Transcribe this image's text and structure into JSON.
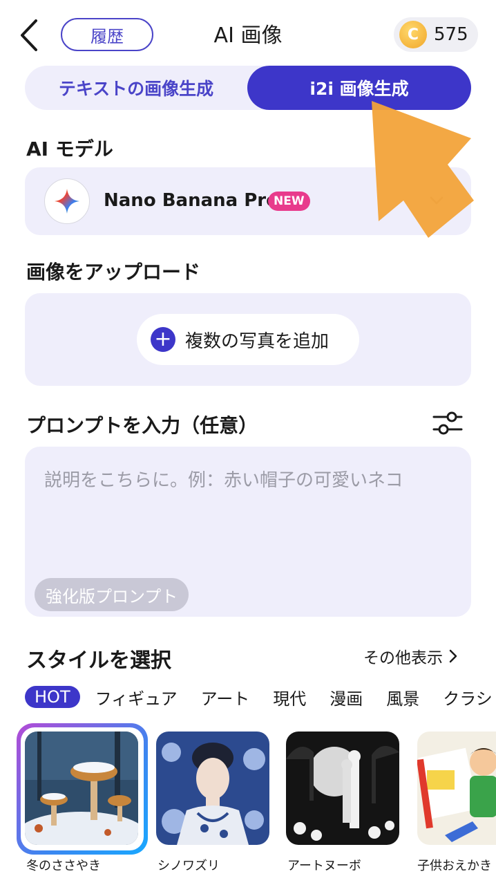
{
  "header": {
    "back_icon": "chevron-left-icon",
    "history_label": "履歴",
    "title": "AI 画像",
    "coin_symbol": "C",
    "coin_count": "575"
  },
  "tabs": [
    {
      "label": "テキストの画像生成",
      "active": false
    },
    {
      "label": "i2i 画像生成",
      "active": true
    }
  ],
  "model": {
    "section_label": "AI モデル",
    "name": "Nano Banana Pro",
    "badge": "NEW"
  },
  "upload": {
    "section_label": "画像をアップロード",
    "button_label": "複数の写真を追加"
  },
  "prompt": {
    "section_label": "プロンプトを入力（任意）",
    "placeholder": "説明をこちらに。例：赤い帽子の可愛いネコ",
    "enhance_label": "強化版プロンプト"
  },
  "styles": {
    "section_label": "スタイルを選択",
    "more_label": "その他表示",
    "categories": [
      "HOT",
      "フィギュア",
      "アート",
      "現代",
      "漫画",
      "風景",
      "クラシ"
    ],
    "items": [
      {
        "caption": "冬のささやき",
        "selected": true
      },
      {
        "caption": "シノワズリ",
        "selected": false
      },
      {
        "caption": "アートヌーボ",
        "selected": false
      },
      {
        "caption": "子供おえかき",
        "selected": false
      }
    ]
  },
  "colors": {
    "accent": "#3d36c9",
    "card_bg": "#efeefb",
    "badge": "#e83b8c",
    "arrow_overlay": "#f2a33a"
  }
}
